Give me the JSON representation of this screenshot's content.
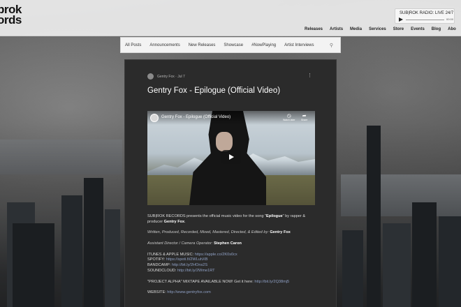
{
  "header": {
    "logo_line1": "brok",
    "logo_line2": "ords",
    "radio": {
      "title": "SUB|ROK RADIO: LIVE 24/7",
      "time": "00:00"
    },
    "nav": [
      "Releases",
      "Artists",
      "Media",
      "Services",
      "Store",
      "Events",
      "Blog",
      "Abo"
    ]
  },
  "blog_nav": {
    "categories": [
      "All Posts",
      "Announcements",
      "New Releases",
      "Showcase",
      "#NowPlaying",
      "Artist Interviews"
    ]
  },
  "post": {
    "author": "Gentry Fox",
    "date": "Jul 7",
    "title": "Gentry Fox - Epilogue (Official Video)",
    "video": {
      "title": "Gentry Fox - Epilogue (Official Video)",
      "watch_later": "Watch later",
      "share": "Share"
    },
    "intro": {
      "a": "SUB|ROK RECORDS presents the official music video for the song \"",
      "song": "Epilogue",
      "b": "\" by rapper &",
      "c": "producer ",
      "producer": "Gentry Fox",
      "d": "."
    },
    "credits": {
      "label": "Written, Produced, Recorded, Mixed, Mastered, Directed, & Edited by: ",
      "name": "Gentry Fox"
    },
    "assistant": {
      "label": "Assistant Director / Camera Operator: ",
      "name": "Stephen Caron"
    },
    "links": [
      {
        "label": "ITUNES & APPLE MUSIC: ",
        "url": "https://apple.co/2K0s0cx"
      },
      {
        "label": "SPOTIFY: ",
        "url": "https://spoti.fi/2WLuhXB"
      },
      {
        "label": "BANDCAMP: ",
        "url": "http://bit.ly/2HOns2S"
      },
      {
        "label": "SOUNDCLOUD: ",
        "url": "http://bit.ly/2Wme1RT"
      }
    ],
    "mixtape": {
      "label": "\"PROJECT ALPHA\" MIXTAPE AVAILABLE NOW! Get it here: ",
      "url": "http://bit.ly/2Q38mj5"
    },
    "website": {
      "label": "WEBSITE: ",
      "url": "http://www.gentryfox.com"
    }
  }
}
